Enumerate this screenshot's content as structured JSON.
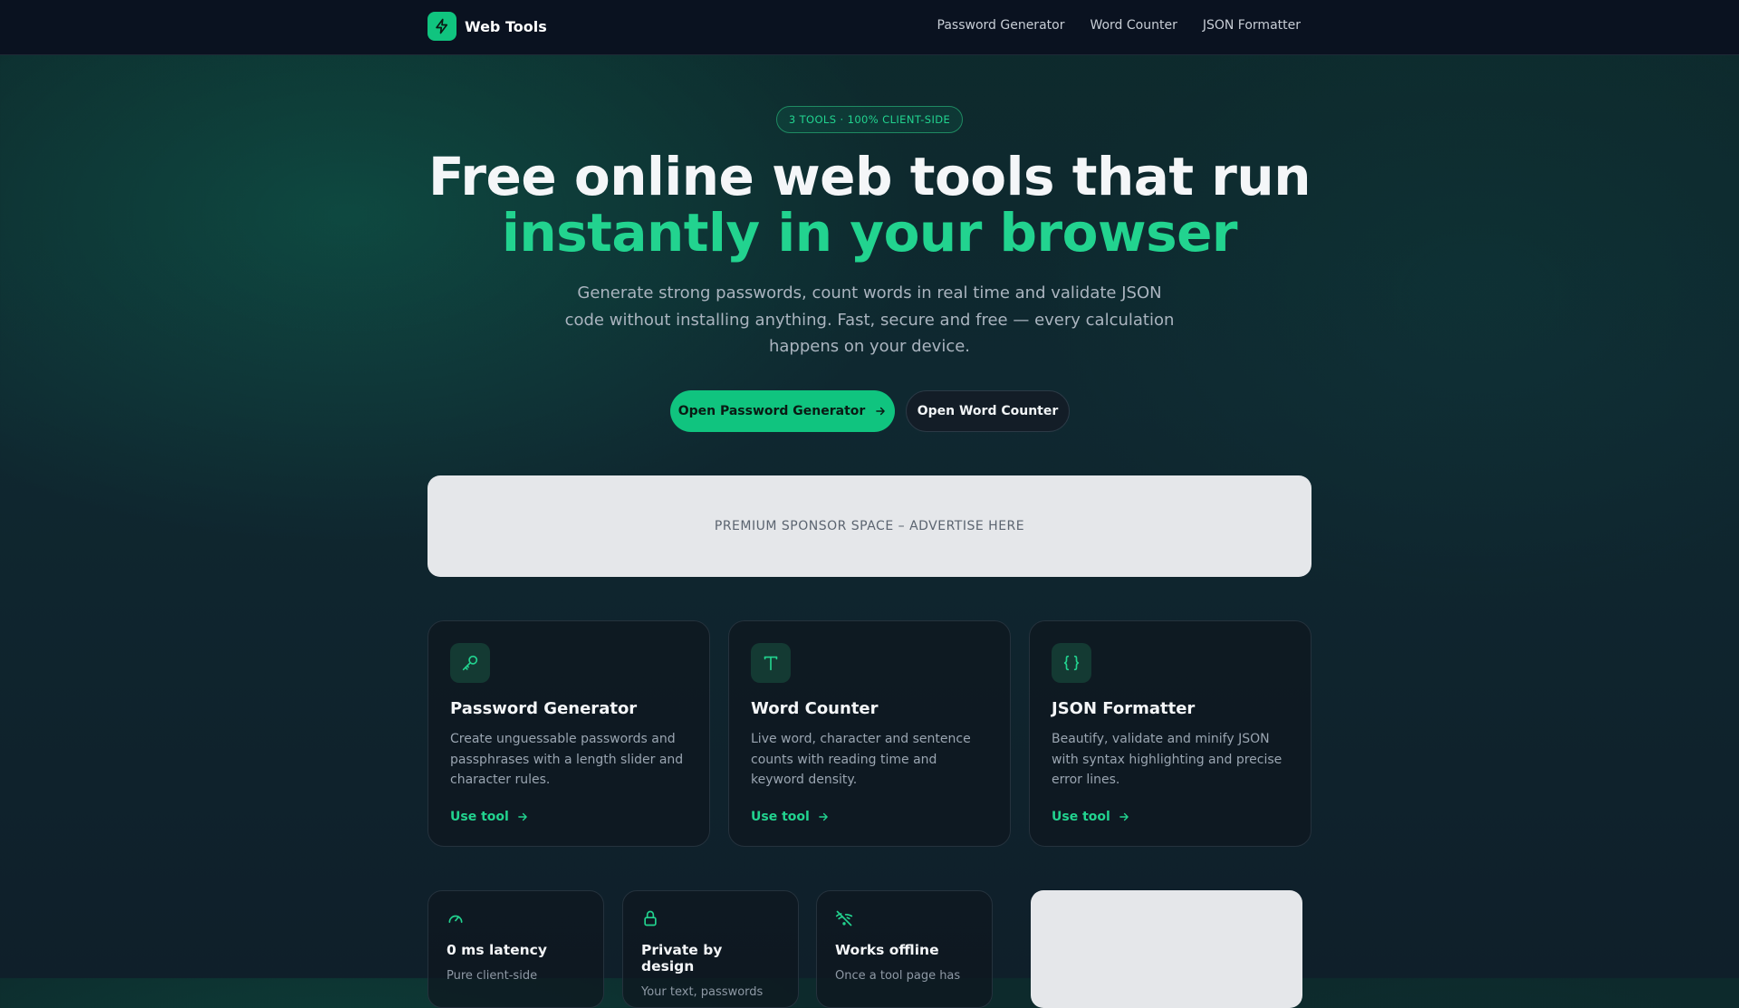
{
  "brand": {
    "name": "Web Tools",
    "icon": "bolt-icon"
  },
  "nav": {
    "items": [
      {
        "label": "Password Generator"
      },
      {
        "label": "Word Counter"
      },
      {
        "label": "JSON Formatter"
      }
    ]
  },
  "hero": {
    "pill": "3 TOOLS · 100% CLIENT-SIDE",
    "title_line1": "Free online web tools that run",
    "title_line2": "instantly in your browser",
    "lead": "Generate strong passwords, count words in real time and validate JSON code without installing anything. Fast, secure and free — every calculation happens on your device.",
    "primary_button": "Open Password Generator",
    "secondary_button": "Open Word Counter"
  },
  "ad": {
    "banner_text": "PREMIUM SPONSOR SPACE – ADVERTISE HERE"
  },
  "tools": [
    {
      "icon": "key-icon",
      "title": "Password Generator",
      "desc": "Create unguessable passwords and passphrases with a length slider and character rules.",
      "link": "Use tool"
    },
    {
      "icon": "text-type-icon",
      "title": "Word Counter",
      "desc": "Live word, character and sentence counts with reading time and keyword density.",
      "link": "Use tool"
    },
    {
      "icon": "braces-icon",
      "title": "JSON Formatter",
      "desc": "Beautify, validate and minify JSON with syntax highlighting and precise error lines.",
      "link": "Use tool"
    }
  ],
  "features": [
    {
      "icon": "gauge-icon",
      "title": "0 ms latency",
      "desc": "Pure client-side"
    },
    {
      "icon": "lock-icon",
      "title": "Private by design",
      "desc": "Your text, passwords"
    },
    {
      "icon": "wifi-off-icon",
      "title": "Works offline",
      "desc": "Once a tool page has"
    }
  ],
  "colors": {
    "accent": "#10c47f",
    "accent_text": "#22d38f",
    "nav_bg": "#0a1220",
    "ad_bg": "#e5e7ea"
  }
}
